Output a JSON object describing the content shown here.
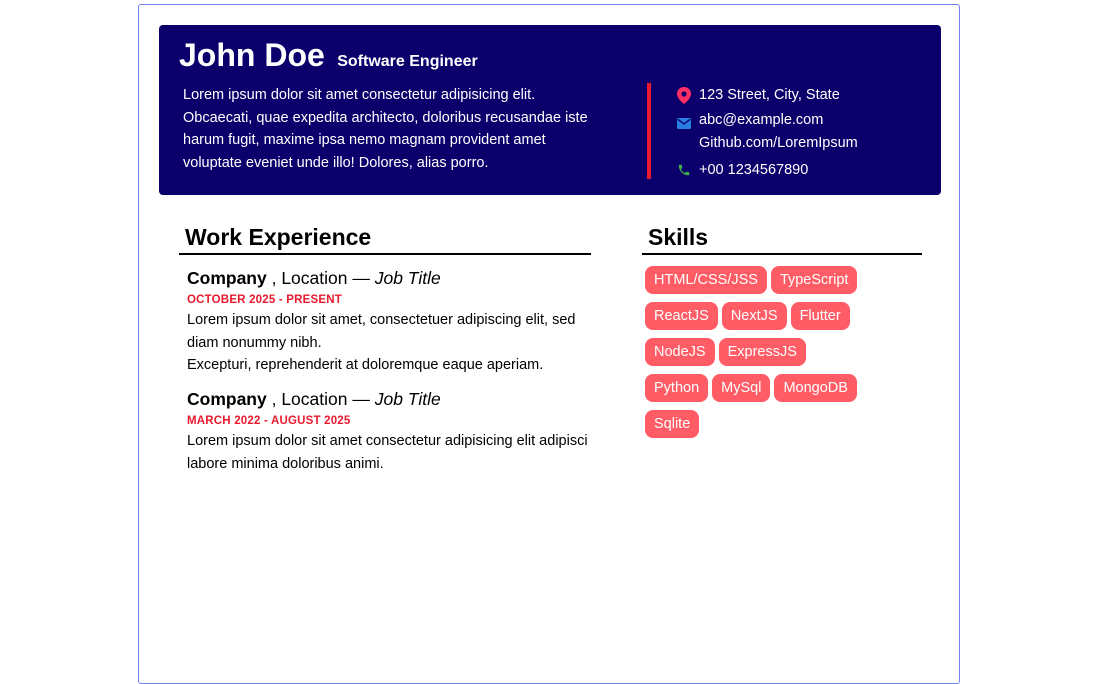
{
  "header": {
    "name": "John Doe",
    "role": "Software Engineer",
    "summary": "Lorem ipsum dolor sit amet consectetur adipisicing elit. Obcaecati, quae expedita architecto, doloribus recusandae iste harum fugit, maxime ipsa nemo magnam provident amet voluptate eveniet unde illo! Dolores, alias porro.",
    "contact": {
      "address": "123 Street, City, State",
      "email": "abc@example.com",
      "github": "Github.com/LoremIpsum",
      "phone": "+00 1234567890"
    }
  },
  "work": {
    "title": "Work Experience",
    "jobs": [
      {
        "company": "Company",
        "location": " , Location — ",
        "job_title": "Job Title",
        "dates": "OCTOBER 2025 - PRESENT",
        "desc_line1": "Lorem ipsum dolor sit amet, consectetuer adipiscing elit, sed diam nonummy nibh.",
        "desc_line2": "Excepturi, reprehenderit at doloremque eaque aperiam."
      },
      {
        "company": "Company",
        "location": " , Location — ",
        "job_title": "Job Title",
        "dates": "MARCH 2022 - AUGUST 2025",
        "desc_line1": "Lorem ipsum dolor sit amet consectetur adipisicing elit adipisci labore minima doloribus animi."
      }
    ]
  },
  "skills": {
    "title": "Skills",
    "items": [
      "HTML/CSS/JSS",
      "TypeScript",
      "ReactJS",
      "NextJS",
      "Flutter",
      "NodeJS",
      "ExpressJS",
      "Python",
      "MySql",
      "MongoDB",
      "Sqlite"
    ]
  },
  "colors": {
    "header_bg": "#0b006b",
    "accent_red": "#e8192c",
    "skill_bg": "#ff5c66",
    "page_border": "#6f7ff0",
    "location_icon": "#ff2e63",
    "email_icon": "#2a7de1",
    "phone_icon": "#3fae49"
  },
  "icons": {
    "address": "location-pin-icon",
    "email": "envelope-icon",
    "phone": "phone-icon"
  }
}
